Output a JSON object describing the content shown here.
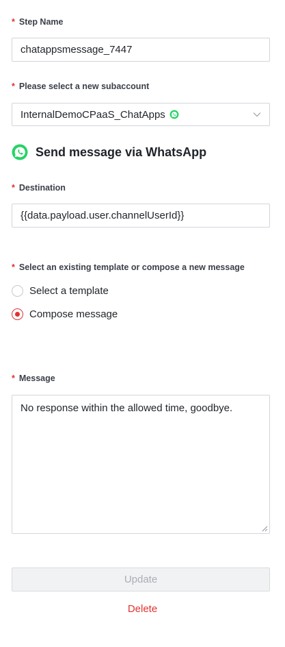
{
  "step_name": {
    "label": "Step Name",
    "required_mark": "*",
    "value": "chatappsmessage_7447"
  },
  "subaccount": {
    "label": "Please select a new subaccount",
    "required_mark": "*",
    "selected": "InternalDemoCPaaS_ChatApps",
    "icon": "whatsapp-icon",
    "dropdown_icon": "chevron-down-icon"
  },
  "section": {
    "title": "Send message via WhatsApp",
    "icon": "whatsapp-icon",
    "icon_color": "#25D366"
  },
  "destination": {
    "label": "Destination",
    "required_mark": "*",
    "value": "{{data.payload.user.channelUserId}}"
  },
  "message_mode": {
    "label": "Select an existing template or compose a new message",
    "required_mark": "*",
    "options": [
      {
        "label": "Select a template",
        "checked": false
      },
      {
        "label": "Compose message",
        "checked": true
      }
    ]
  },
  "message": {
    "label": "Message",
    "required_mark": "*",
    "value": "No response within the allowed time, goodbye."
  },
  "actions": {
    "update_label": "Update",
    "delete_label": "Delete"
  },
  "colors": {
    "accent": "#e03131",
    "whatsapp": "#25D366",
    "border": "#d2d5da",
    "disabled_bg": "#f1f2f4",
    "disabled_text": "#a9adb3"
  }
}
